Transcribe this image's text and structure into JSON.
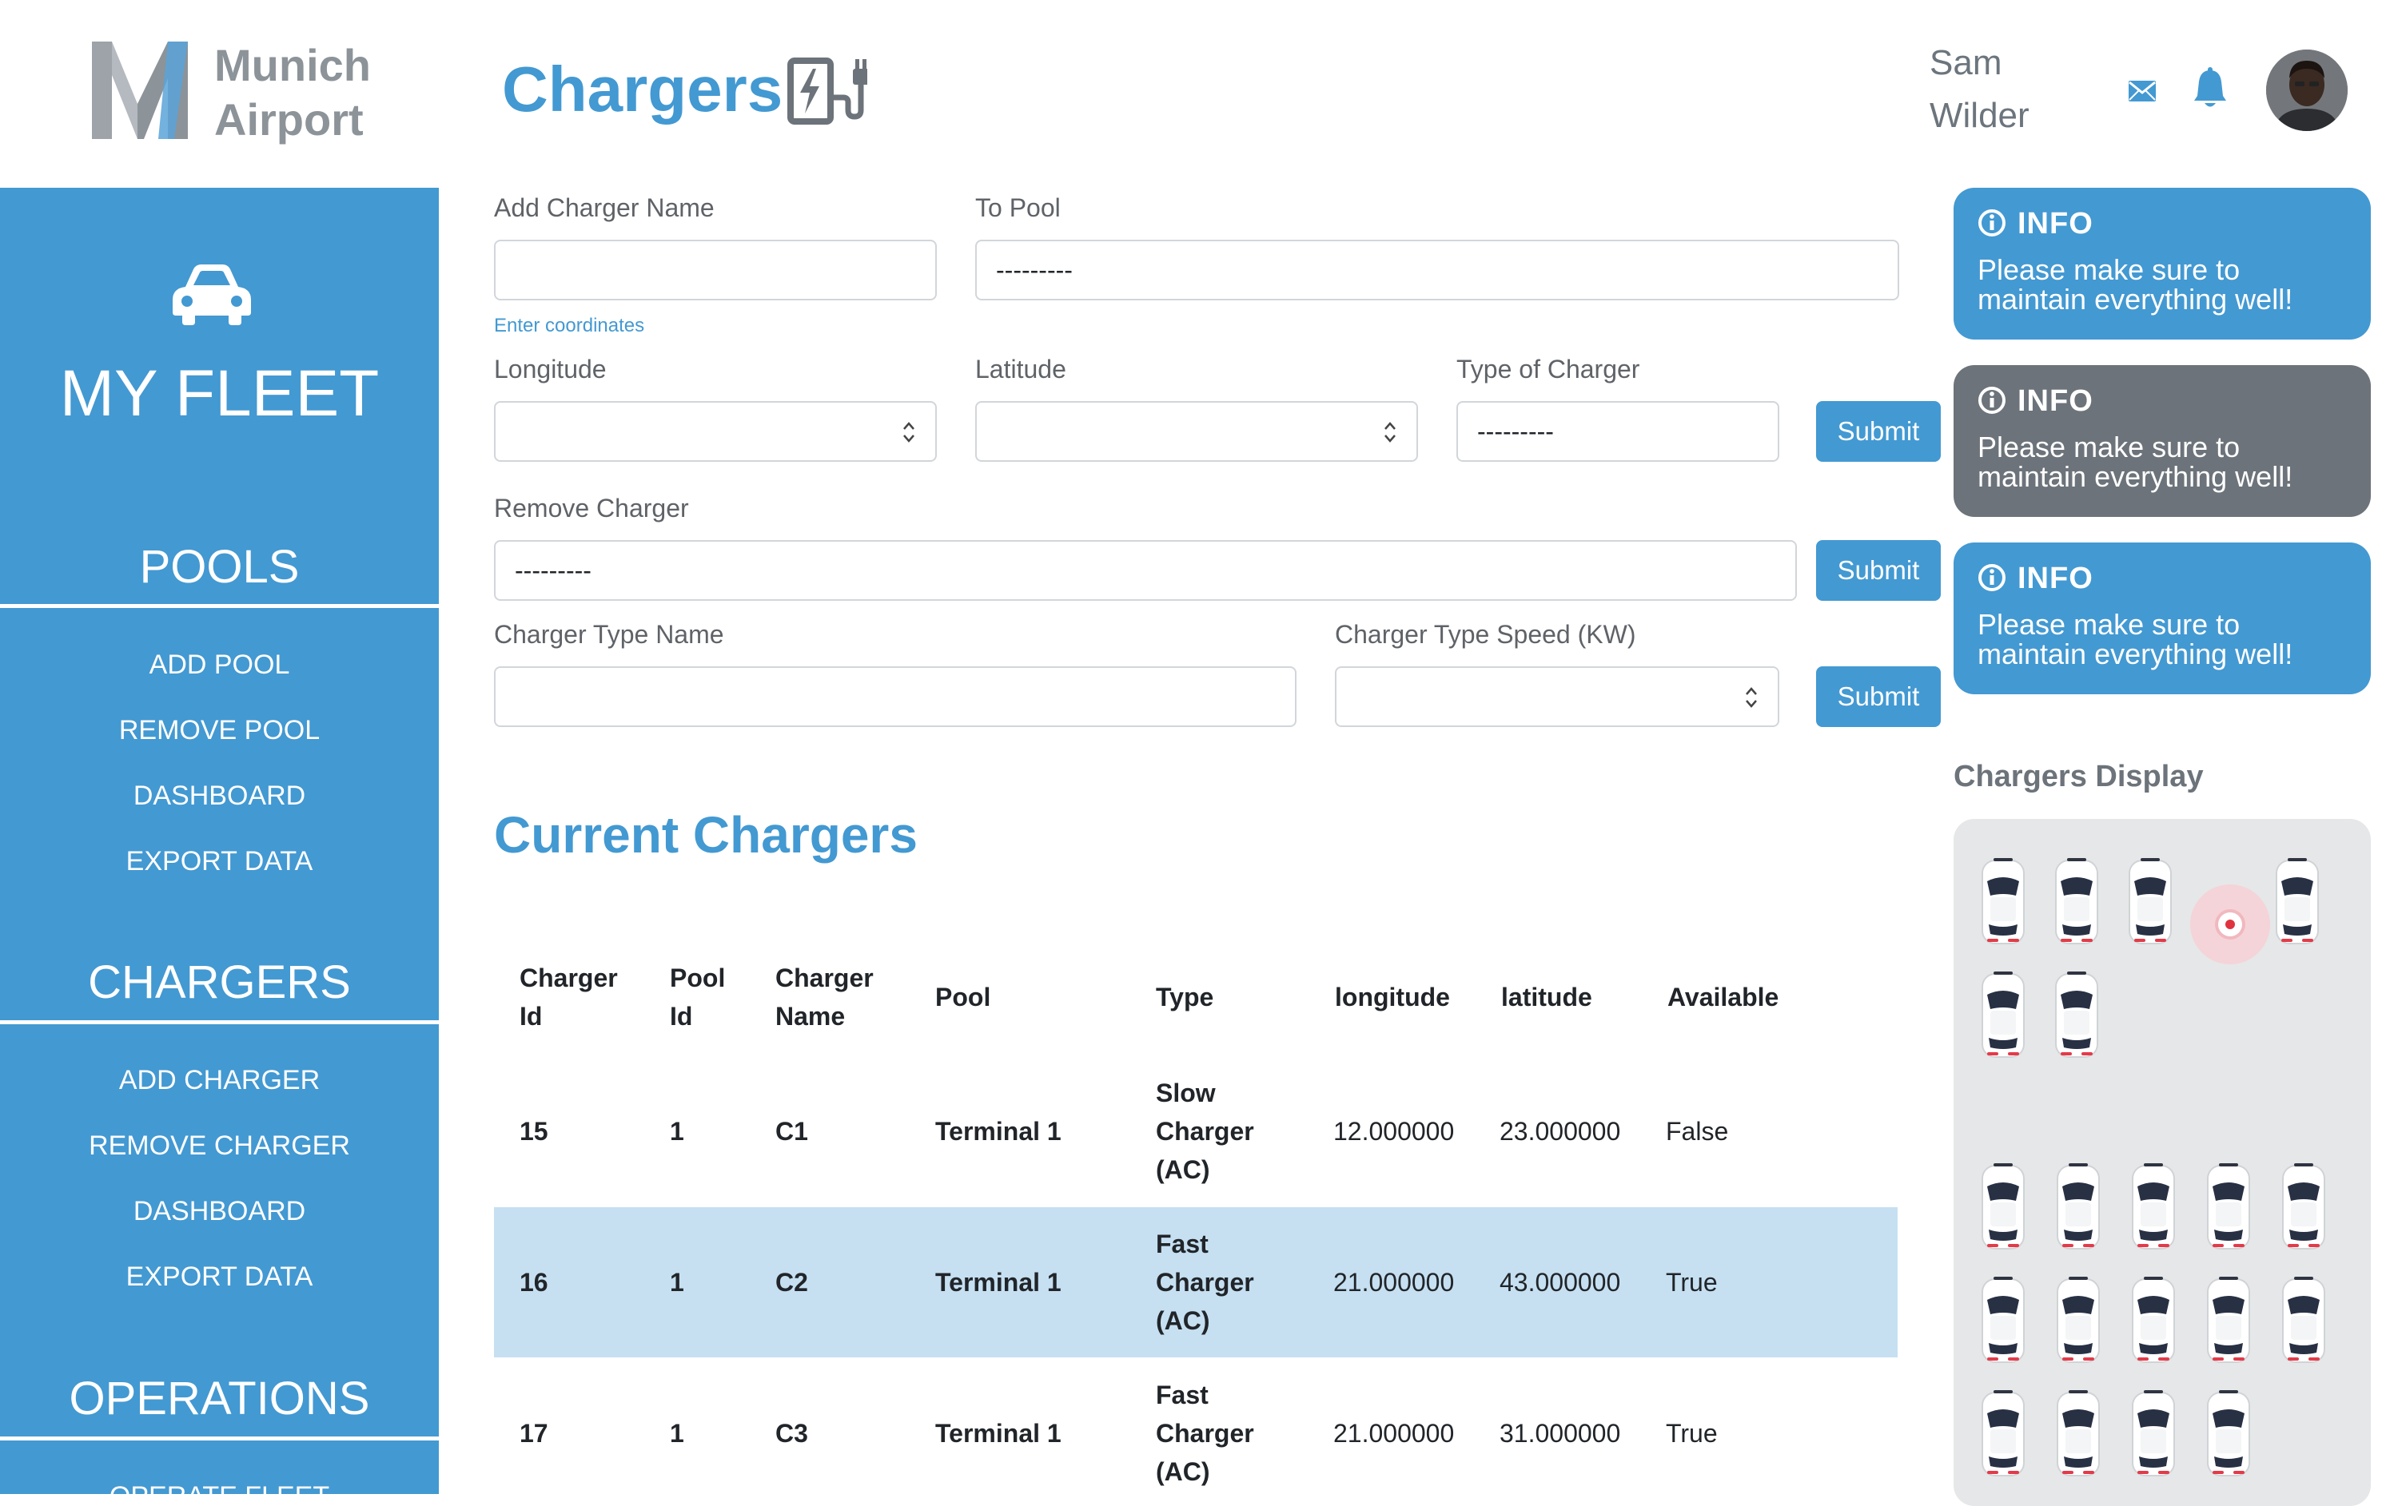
{
  "brand": {
    "line1": "Munich",
    "line2": "Airport",
    "colors": {
      "primary": "#4399d2",
      "grey": "#6c737a",
      "row_highlight": "#c6e0f2"
    }
  },
  "sidebar": {
    "fleet_icon": "car-icon",
    "title": "MY FLEET",
    "sections": [
      {
        "title": "POOLS",
        "items": [
          "ADD POOL",
          "REMOVE POOL",
          "DASHBOARD",
          "EXPORT DATA"
        ]
      },
      {
        "title": "CHARGERS",
        "items": [
          "ADD CHARGER",
          "REMOVE CHARGER",
          "DASHBOARD",
          "EXPORT DATA"
        ]
      },
      {
        "title": "OPERATIONS",
        "items": [
          "OPERATE FLEET"
        ]
      }
    ]
  },
  "header": {
    "title": "Chargers",
    "title_icon": "ev-charger-icon",
    "user_first": "Sam",
    "user_last": "Wilder",
    "icons": [
      "mail-icon",
      "bell-icon"
    ]
  },
  "form": {
    "add_charger_name_label": "Add Charger Name",
    "add_charger_name_value": "",
    "to_pool_label": "To Pool",
    "to_pool_value": "---------",
    "coords_hint": "Enter coordinates",
    "longitude_label": "Longitude",
    "longitude_value": "",
    "latitude_label": "Latitude",
    "latitude_value": "",
    "type_label": "Type of Charger",
    "type_value": "---------",
    "submit_label": "Submit",
    "remove_label": "Remove Charger",
    "remove_value": "---------",
    "type_name_label": "Charger Type Name",
    "type_name_value": "",
    "type_speed_label": "Charger Type Speed (KW)",
    "type_speed_value": ""
  },
  "table": {
    "title": "Current Chargers",
    "headers": [
      [
        "Charger",
        "Id"
      ],
      [
        "Pool",
        "Id"
      ],
      [
        "Charger",
        "Name"
      ],
      [
        "Pool"
      ],
      [
        "Type"
      ],
      [
        "longitude"
      ],
      [
        "latitude"
      ],
      [
        "Available"
      ]
    ],
    "rows": [
      {
        "id": "15",
        "pool_id": "1",
        "name": "C1",
        "pool": "Terminal 1",
        "type": [
          "Slow",
          "Charger",
          "(AC)"
        ],
        "longitude": "12.000000",
        "latitude": "23.000000",
        "available": "False"
      },
      {
        "id": "16",
        "pool_id": "1",
        "name": "C2",
        "pool": "Terminal 1",
        "type": [
          "Fast",
          "Charger",
          "(AC)"
        ],
        "longitude": "21.000000",
        "latitude": "43.000000",
        "available": "True"
      },
      {
        "id": "17",
        "pool_id": "1",
        "name": "C3",
        "pool": "Terminal 1",
        "type": [
          "Fast",
          "Charger",
          "(AC)"
        ],
        "longitude": "21.000000",
        "latitude": "31.000000",
        "available": "True"
      }
    ]
  },
  "info_cards": [
    {
      "title": "INFO",
      "message": "Please make sure to maintain everything well!",
      "color": "#4399d2"
    },
    {
      "title": "INFO",
      "message": "Please make sure to maintain everything well!",
      "color": "#6c737a"
    },
    {
      "title": "INFO",
      "message": "Please make sure to maintain everything well!",
      "color": "#4399d2"
    }
  ],
  "display": {
    "title": "Chargers Display",
    "car_icon": "car-topview-icon",
    "group1_count": 6,
    "group2_count": 14,
    "alert_icon": "alert-pulse-icon"
  }
}
